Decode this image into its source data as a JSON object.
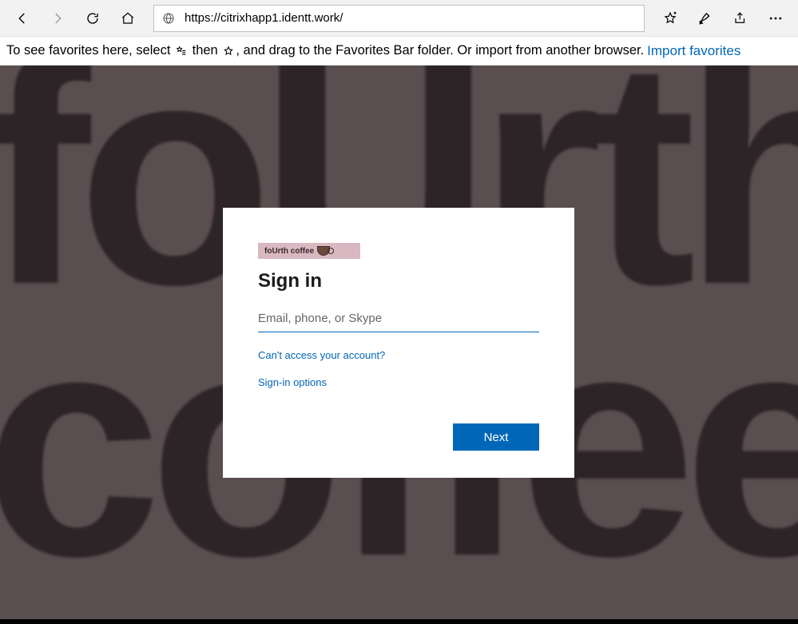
{
  "browser": {
    "url": "https://citrixhapp1.identt.work/"
  },
  "favbar": {
    "text_before": "To see favorites here, select",
    "text_middle": "then",
    "text_after": ", and drag to the Favorites Bar folder. Or import from another browser.",
    "import_link": "Import favorites"
  },
  "brand": {
    "name": "foUrth coffee",
    "line1": "foUrth",
    "line2": "coffee"
  },
  "signin": {
    "title": "Sign in",
    "placeholder": "Email, phone, or Skype",
    "cant_access": "Can't access your account?",
    "options": "Sign-in options",
    "next": "Next"
  }
}
